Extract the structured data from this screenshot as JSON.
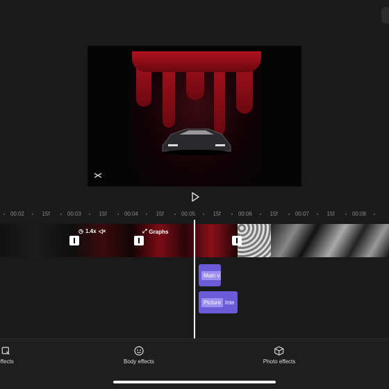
{
  "preview": {
    "watermark_icon": "capcut-logo-icon",
    "play_icon": "play-icon"
  },
  "ruler": {
    "labels": [
      "00:02",
      "15f",
      "00:03",
      "15f",
      "00:04",
      "15f",
      "00:05",
      "15f",
      "00:06",
      "15f",
      "00:07",
      "15f",
      "00:08"
    ]
  },
  "track": {
    "speed_label": "1.4x",
    "graphs_label": "Graphs"
  },
  "clips": {
    "main": "Main v",
    "picture_tag": "Picture",
    "picture_rest": "Inte"
  },
  "toolbar": {
    "items": [
      {
        "label": "effects",
        "icon": "effects-icon"
      },
      {
        "label": "Body effects",
        "icon": "body-effects-icon"
      },
      {
        "label": "Photo effects",
        "icon": "photo-effects-icon"
      }
    ]
  },
  "colors": {
    "accent": "#6b5bd6",
    "blood": "#b0121f",
    "background": "#1a1a1a"
  }
}
